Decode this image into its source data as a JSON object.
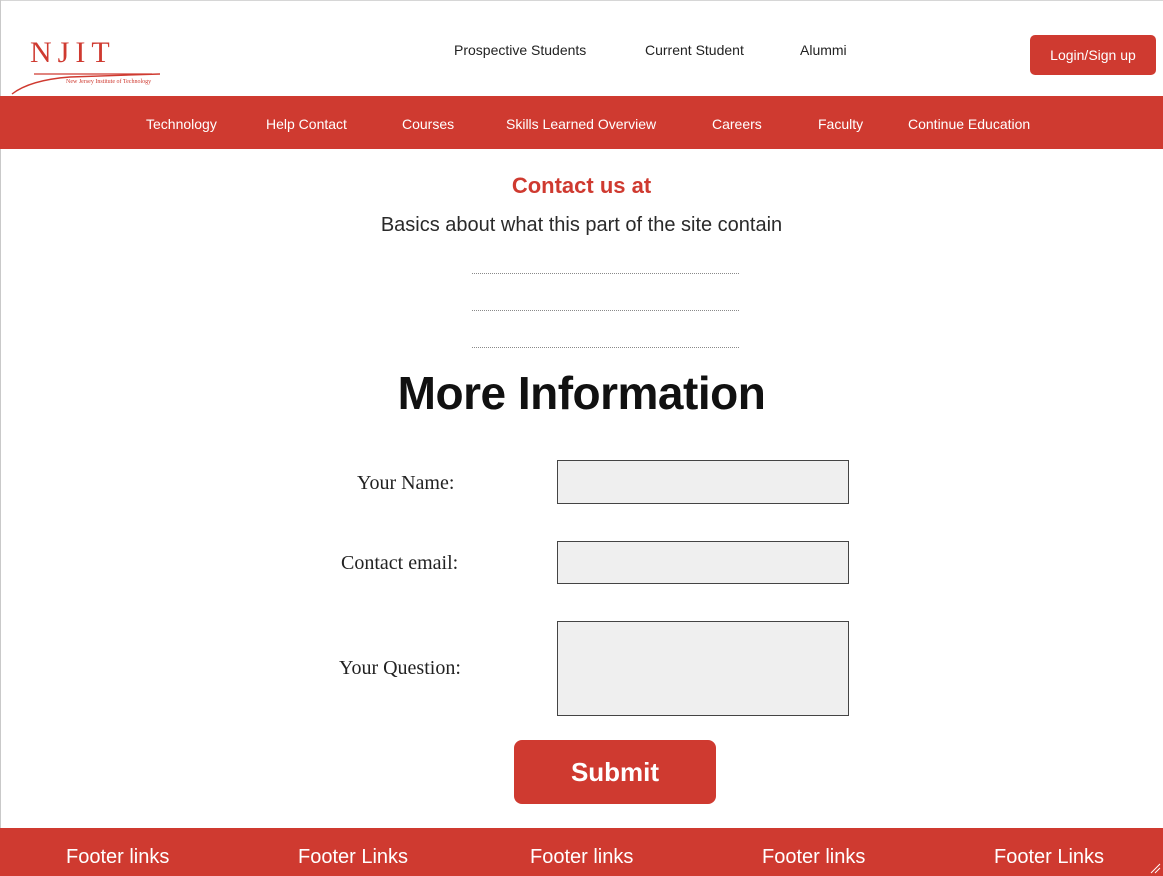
{
  "logo": {
    "letters": "NJIT",
    "subtitle": "New Jersey Institute of Technology"
  },
  "top_links": [
    "Prospective Students",
    "Current Student",
    "Alummi"
  ],
  "login_label": "Login/Sign up",
  "nav_items": [
    "Technology",
    "Help Contact",
    "Courses",
    "Skills Learned Overview",
    "Careers",
    "Faculty",
    "Continue Education"
  ],
  "contact": {
    "title": "Contact us at",
    "subtitle": "Basics about what this part of the site contain"
  },
  "more_info_title": "More Information",
  "form": {
    "name_label": "Your Name:",
    "name_value": "",
    "email_label": "Contact email:",
    "email_value": "",
    "question_label": "Your Question:",
    "question_value": "",
    "submit_label": "Submit"
  },
  "footer_links": [
    "Footer links",
    "Footer Links",
    "Footer links",
    "Footer links",
    "Footer Links"
  ],
  "colors": {
    "brand_red": "#cf3a30",
    "field_bg": "#efefef"
  }
}
